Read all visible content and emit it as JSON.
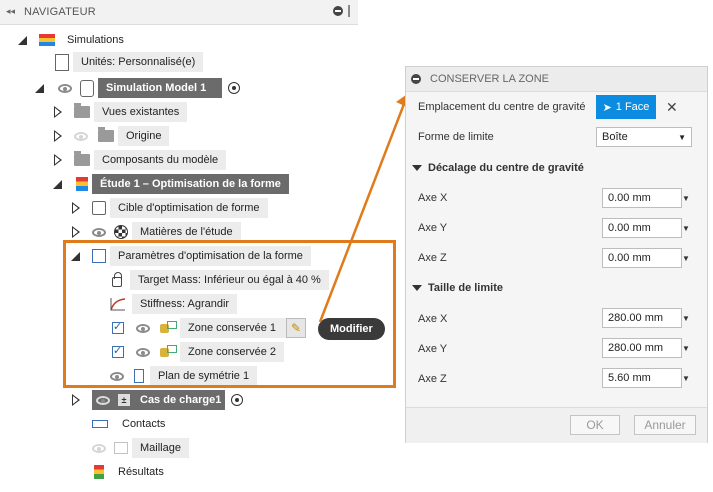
{
  "navigator": {
    "title": "NAVIGATEUR",
    "collapse_glyph": "◂◂",
    "items": {
      "simulations": "Simulations",
      "units": "Unités: Personnalisé(e)",
      "sim_model": "Simulation Model 1",
      "existing_views": "Vues existantes",
      "origin": "Origine",
      "model_components": "Composants du modèle",
      "study": "Étude 1 – Optimisation de la forme",
      "shape_target": "Cible d'optimisation de forme",
      "study_materials": "Matières de l'étude",
      "shape_params": "Paramètres d'optimisation de la forme",
      "target_mass": "Target Mass: Inférieur ou égal à  40 %",
      "stiffness": "Stiffness: Agrandir",
      "zone1": "Zone conservée 1",
      "zone2": "Zone conservée 2",
      "symmetry": "Plan de symétrie 1",
      "load_case": "Cas de charge1",
      "contacts": "Contacts",
      "mesh": "Maillage",
      "results": "Résultats"
    }
  },
  "tooltip": {
    "modifier": "Modifier"
  },
  "panel": {
    "title": "CONSERVER LA ZONE",
    "centroid_label": "Emplacement du centre de gravité",
    "face_button": "1 Face",
    "close_glyph": "✕",
    "shape_label": "Forme de limite",
    "shape_value": "Boîte",
    "offset_section": "Décalage du centre de gravité",
    "offset": [
      {
        "axis": "Axe X",
        "value": "0.00 mm"
      },
      {
        "axis": "Axe Y",
        "value": "0.00 mm"
      },
      {
        "axis": "Axe Z",
        "value": "0.00 mm"
      }
    ],
    "size_section": "Taille de limite",
    "size": [
      {
        "axis": "Axe X",
        "value": "280.00 mm"
      },
      {
        "axis": "Axe Y",
        "value": "280.00 mm"
      },
      {
        "axis": "Axe Z",
        "value": "5.60 mm"
      }
    ],
    "ok_label": "OK",
    "cancel_label": "Annuler"
  },
  "colors": {
    "highlight": "#e07b1b",
    "accent": "#0c8ce0"
  }
}
